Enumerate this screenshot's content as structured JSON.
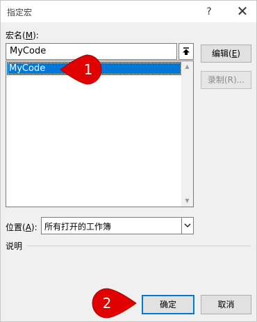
{
  "window": {
    "title": "指定宏",
    "help": "?",
    "close": "✕"
  },
  "macro_name": {
    "label": "宏名",
    "mnemonic": "M",
    "value": "MyCode"
  },
  "macro_list": {
    "items": [
      "MyCode"
    ],
    "selected": 0
  },
  "side_buttons": {
    "edit_label": "编辑",
    "edit_key": "E",
    "record_label": "录制(R)..."
  },
  "location": {
    "label": "位置",
    "mnemonic": "A",
    "value": "所有打开的工作簿"
  },
  "description": {
    "label": "说明"
  },
  "footer": {
    "ok_label": "确定",
    "cancel_label": "取消"
  },
  "callouts": {
    "one": "1",
    "two": "2",
    "color": "#e00000"
  }
}
